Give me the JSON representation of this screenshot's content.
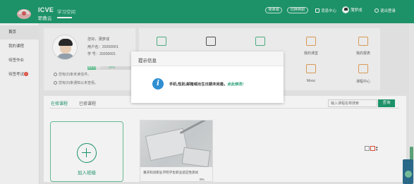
{
  "header": {
    "logo_en": "ICVE",
    "logo_cn": "职教云",
    "logo_sub": "学习空间",
    "pills": [
      "授课端",
      "切换到职"
    ],
    "message_center": "消息中心",
    "username": "蒲梦成",
    "logout": "退出登录"
  },
  "sidebar": {
    "items": [
      {
        "label": "首页"
      },
      {
        "label": "我的课程"
      },
      {
        "label": "待签作业"
      },
      {
        "label": "待签考试"
      }
    ],
    "exam_badge": "1"
  },
  "profile": {
    "greeting": "您好，蒲梦成",
    "user_id": "用户名：20200001",
    "student_id": "学   号：20200001",
    "progress_label": "资料完整：",
    "progress_value": "20%",
    "progress_fraction": 0.2,
    "note1": "您有(0)条未读信件。",
    "note2": "您有(0)条通知以未查看。"
  },
  "menu": {
    "row1_labels": [
      "",
      "",
      "",
      "我的课堂",
      "我的报表"
    ],
    "row2_labels": [
      "",
      "",
      "",
      "Mooc",
      "课程中心"
    ],
    "row2_icon_note": "MOOC"
  },
  "tabs": {
    "items": [
      "在修课程",
      "已修课程"
    ],
    "search_placeholder": "输入课程名称搜索",
    "search_button": "查询"
  },
  "add_class": {
    "label": "加入班级"
  },
  "course": {
    "title": "重庆科创职业学院学生职业适应性测试",
    "progress": "0%"
  },
  "modal": {
    "title": "提示信息",
    "message": "手机,性别,邮箱或出生日期未完善。",
    "link": "点此修改!"
  },
  "colors": {
    "brand_green": "#1f9a6f",
    "info_blue": "#2f8fd1",
    "badge_red": "#e74c3c"
  }
}
